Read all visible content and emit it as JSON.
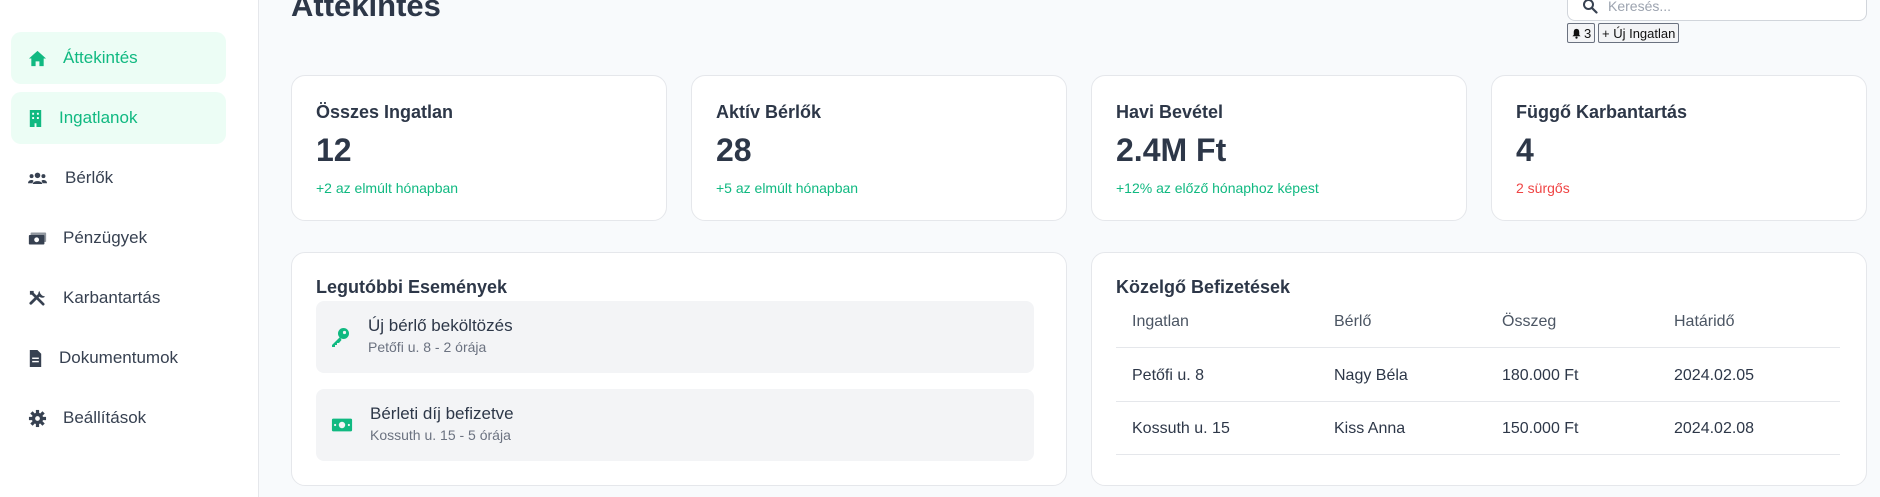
{
  "sidebar": {
    "items": [
      {
        "label": "Áttekintés",
        "icon": "home-icon",
        "active": true
      },
      {
        "label": "Ingatlanok",
        "icon": "building-icon",
        "active": true
      },
      {
        "label": "Bérlők",
        "icon": "users-icon",
        "active": false
      },
      {
        "label": "Pénzügyek",
        "icon": "money-icon",
        "active": false
      },
      {
        "label": "Karbantartás",
        "icon": "tools-icon",
        "active": false
      },
      {
        "label": "Dokumentumok",
        "icon": "document-icon",
        "active": false
      },
      {
        "label": "Beállítások",
        "icon": "gear-icon",
        "active": false
      }
    ]
  },
  "header": {
    "title": "Áttekintés",
    "search_placeholder": "Keresés...",
    "notifications_count": "3",
    "new_property_label": "+ Új Ingatlan"
  },
  "stats": [
    {
      "title": "Összes Ingatlan",
      "value": "12",
      "note": "+2 az elmúlt hónapban",
      "note_color": "#10b981"
    },
    {
      "title": "Aktív Bérlők",
      "value": "28",
      "note": "+5 az elmúlt hónapban",
      "note_color": "#10b981"
    },
    {
      "title": "Havi Bevétel",
      "value": "2.4M Ft",
      "note": "+12% az előző hónaphoz képest",
      "note_color": "#10b981"
    },
    {
      "title": "Függő Karbantartás",
      "value": "4",
      "note": "2 sürgős",
      "note_color": "#ef4444"
    }
  ],
  "events": {
    "title": "Legutóbbi Események",
    "items": [
      {
        "title": "Új bérlő beköltözés",
        "subtitle": "Petőfi u. 8 - 2 órája",
        "icon": "key-icon"
      },
      {
        "title": "Bérleti díj befizetve",
        "subtitle": "Kossuth u. 15 - 5 órája",
        "icon": "money-icon"
      }
    ]
  },
  "payments": {
    "title": "Közelgő Befizetések",
    "columns": [
      "Ingatlan",
      "Bérlő",
      "Összeg",
      "Határidő"
    ],
    "rows": [
      [
        "Petőfi u. 8",
        "Nagy Béla",
        "180.000 Ft",
        "2024.02.05"
      ],
      [
        "Kossuth u. 15",
        "Kiss Anna",
        "150.000 Ft",
        "2024.02.08"
      ]
    ]
  },
  "colors": {
    "accent": "#10b981",
    "urgent": "#ef4444",
    "active_bg": "#ecfdf5",
    "text_dark": "#2d3748"
  }
}
